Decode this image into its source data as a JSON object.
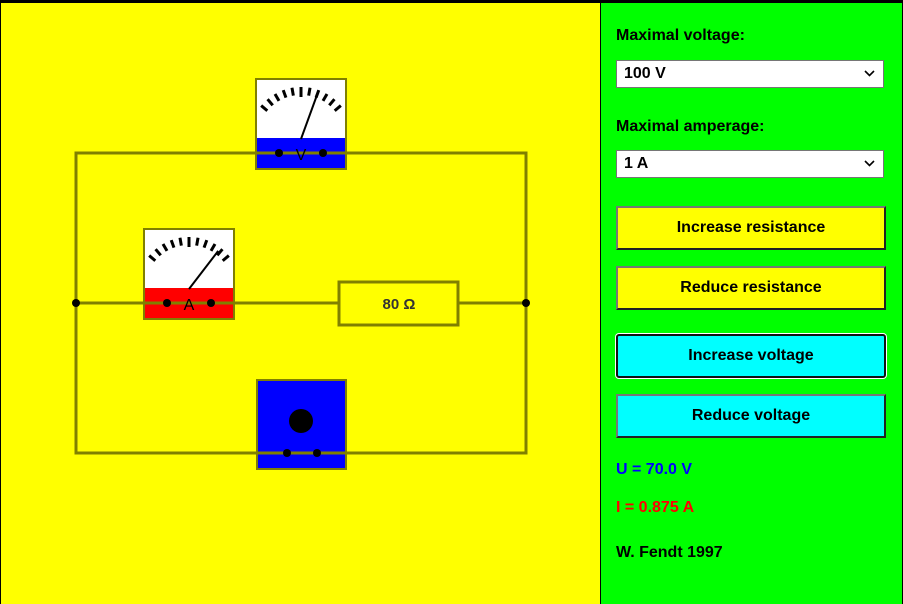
{
  "circuit": {
    "voltmeter_symbol": "V",
    "ammeter_symbol": "A",
    "resistor_label": "80 Ω",
    "voltmeter_needle_fraction": 0.7,
    "ammeter_needle_fraction": 0.875,
    "colors": {
      "background": "#ffff00",
      "wire": "#808000",
      "voltmeter_base": "#0000ff",
      "ammeter_base": "#ff0000",
      "power_supply": "#0000ff"
    }
  },
  "panel": {
    "max_voltage_label": "Maximal voltage:",
    "max_voltage_value": "100 V",
    "max_amperage_label": "Maximal amperage:",
    "max_amperage_value": "1 A",
    "increase_resistance": "Increase resistance",
    "reduce_resistance": "Reduce resistance",
    "increase_voltage": "Increase voltage",
    "reduce_voltage": "Reduce voltage",
    "voltage_readout": "U = 70.0 V",
    "current_readout": "I = 0.875 A",
    "credit": "W. Fendt 1997",
    "colors": {
      "background": "#00ff00",
      "voltage_text": "#0000ff",
      "current_text": "#ff0000"
    }
  }
}
